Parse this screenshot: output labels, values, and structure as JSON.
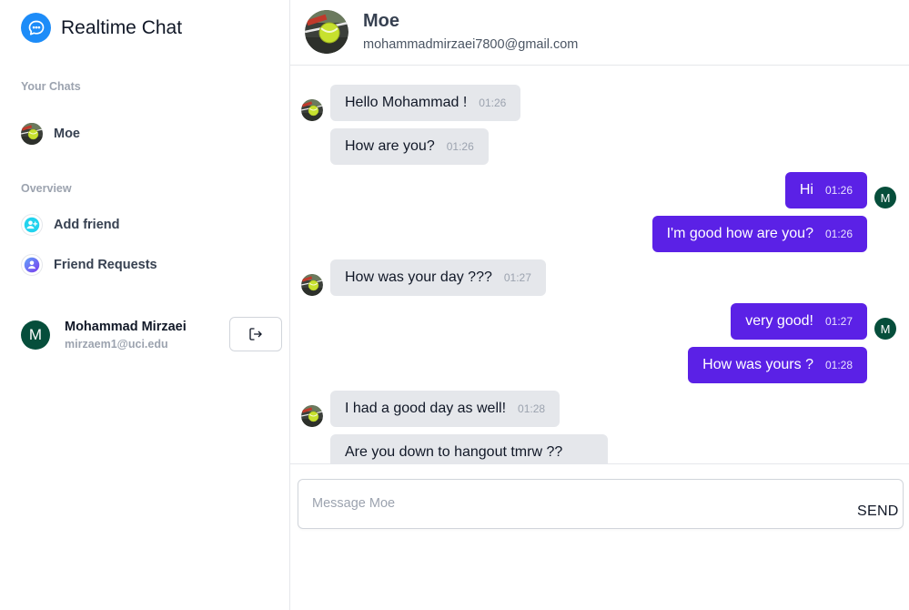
{
  "app": {
    "title": "Realtime Chat",
    "logo_icon": "chat-bubble-icon",
    "accent": "#1d8cf8"
  },
  "sidebar": {
    "chats_label": "Your Chats",
    "chats": [
      {
        "name": "Moe",
        "avatar_icon": "tennis-ball-avatar"
      }
    ],
    "overview_label": "Overview",
    "overview": [
      {
        "label": "Add friend",
        "icon": "user-plus-icon"
      },
      {
        "label": "Friend Requests",
        "icon": "user-icon"
      }
    ],
    "user": {
      "initial": "M",
      "name": "Mohammad Mirzaei",
      "email": "mirzaem1@uci.edu",
      "logout_icon": "logout-icon"
    }
  },
  "chat": {
    "partner": {
      "name": "Moe",
      "email": "mohammadmirzaei7800@gmail.com"
    },
    "messages": [
      {
        "from": "them",
        "text": "Hello Mohammad !",
        "time": "01:26"
      },
      {
        "from": "them",
        "text": "How are you?",
        "time": "01:26"
      },
      {
        "from": "me",
        "text": "Hi",
        "time": "01:26"
      },
      {
        "from": "me",
        "text": "I'm good how are you?",
        "time": "01:26"
      },
      {
        "from": "them",
        "text": "How was your day ???",
        "time": "01:27"
      },
      {
        "from": "me",
        "text": "very good!",
        "time": "01:27"
      },
      {
        "from": "me",
        "text": "How was yours ?",
        "time": "01:28"
      },
      {
        "from": "them",
        "text": "I had a good day as well!",
        "time": "01:28"
      },
      {
        "from": "them",
        "text": "Are you down to hangout tmrw ??",
        "time": ""
      }
    ],
    "my_initial": "M",
    "composer": {
      "placeholder": "Message Moe",
      "value": "",
      "send_label": "SEND"
    },
    "colors": {
      "outgoing": "#5b21e6",
      "incoming": "#e5e7eb"
    }
  }
}
